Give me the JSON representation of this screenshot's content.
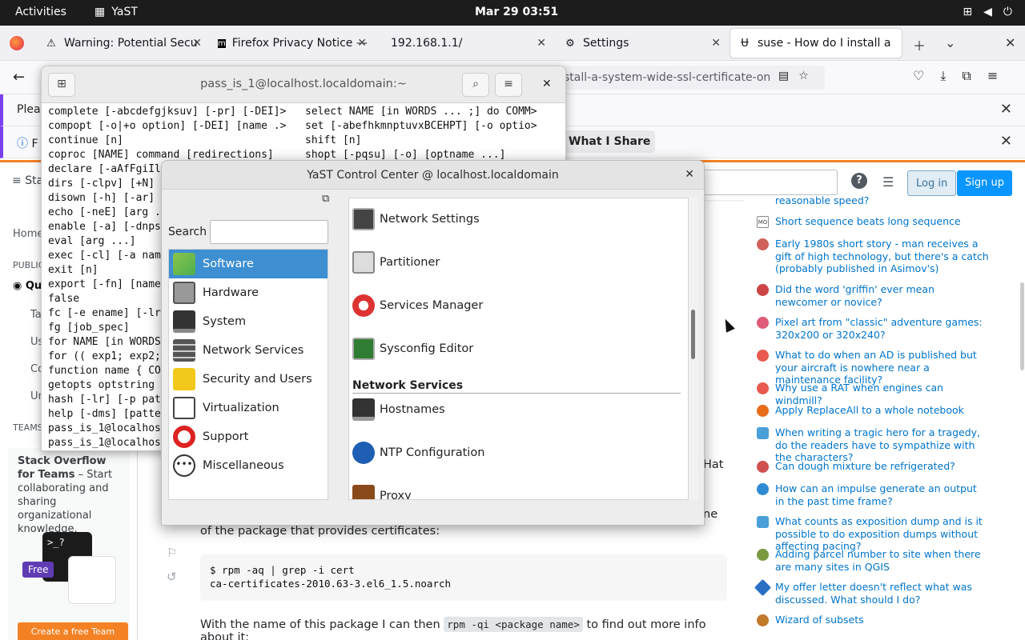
{
  "topbar": {
    "activities": "Activities",
    "app": "YaST",
    "clock": "Mar 29  03:51"
  },
  "tabs": [
    {
      "label": "Warning: Potential Secu",
      "icon": "warning-icon"
    },
    {
      "label": "Firefox Privacy Notice —",
      "icon": "mozilla-icon"
    },
    {
      "label": "192.168.1.1/",
      "icon": ""
    },
    {
      "label": "Settings",
      "icon": "gear-icon"
    },
    {
      "label": "suse - How do I install a",
      "icon": "stackexchange-icon"
    }
  ],
  "nav": {
    "url": "stall-a-system-wide-ssl-certificate-on"
  },
  "notif1": {
    "text": "Pleas"
  },
  "notif2": {
    "text": "F",
    "button": "What I Share"
  },
  "so_header": {
    "left": "Sta",
    "login": "Log in",
    "signup": "Sign up"
  },
  "so_left": {
    "home": "Home",
    "public": "PUBLIC",
    "questions": "Qu",
    "tags": "Ta",
    "users": "Us",
    "companies": "Co",
    "unanswered": "Un",
    "teams": "TEAMS",
    "teams_title": "Stack Overflow for Teams",
    "teams_desc": " – Start collaborating and sharing organizational knowledge.",
    "free": "Free",
    "create": "Create a free Team",
    "art_text": ">_?"
  },
  "so_main": {
    "hat": "Hat",
    "ne": "ne",
    "para1": "of the package that provides certificates:",
    "code_line1": "$ rpm -aq | grep -i cert",
    "code_line2": "ca-certificates-2010.63-3.el6_1.5.noarch",
    "para2_pre": "With the name of this package I can then ",
    "para2_code": "rpm -qi <package name>",
    "para2_post": " to find out more info about it:"
  },
  "hot_questions": [
    {
      "text": "reasonable speed?",
      "color": "#888"
    },
    {
      "text": "Short sequence beats long sequence",
      "color": "#444",
      "fav": "MO"
    },
    {
      "text": "Early 1980s short story - man receives a gift of high technology, but there's a catch (probably published in Asimov's)",
      "color": "#d0605a"
    },
    {
      "text": "Did the word 'griffin' ever mean newcomer or novice?",
      "color": "#c44"
    },
    {
      "text": "Pixel art from \"classic\" adventure games: 320x200 or 320x240?",
      "color": "#e05a7a"
    },
    {
      "text": "What to do when an AD is published but your aircraft is nowhere near a maintenance facility?",
      "color": "#e85a4f"
    },
    {
      "text": "Why use a RAT when engines can windmill?",
      "color": "#e85a4f"
    },
    {
      "text": "Apply ReplaceAll to a whole notebook",
      "color": "#e86c1a"
    },
    {
      "text": "When writing a tragic hero for a tragedy, do the readers have to sympathize with the characters?",
      "color": "#4a9fd8"
    },
    {
      "text": "Can dough mixture be refrigerated?",
      "color": "#d05050"
    },
    {
      "text": "How can an impulse generate an output in the past time frame?",
      "color": "#2f8ad6"
    },
    {
      "text": "What counts as exposition dump and is it possible to do exposition dumps without affecting pacing?",
      "color": "#4a9fd8"
    },
    {
      "text": "Adding parcel number to site when there are many sites in QGIS",
      "color": "#7a9a40"
    },
    {
      "text": "My offer letter doesn't reflect what was discussed. What should I do?",
      "color": "#2a6fc4"
    },
    {
      "text": "Wizard of subsets",
      "color": "#c07a2a"
    }
  ],
  "terminal": {
    "title": "pass_is_1@localhost.localdomain:~",
    "left_lines": [
      "complete [-abcdefgjksuv] [-pr] [-DEI]>",
      "compopt [-o|+o option] [-DEI] [name .>",
      "continue [n]",
      "coproc [NAME] command [redirections]",
      "declare [-aAfFgiIl",
      "dirs [-clpv] [+N]",
      "disown [-h] [-ar]",
      "echo [-neE] [arg .",
      "enable [-a] [-dnps",
      "eval [arg ...]",
      "exec [-cl] [-a nam",
      "exit [n]",
      "export [-fn] [name",
      "false",
      "fc [-e ename] [-lr",
      "fg [job_spec]",
      "for NAME [in WORDS",
      "for (( exp1; exp2;",
      "function name { CO",
      "getopts optstring",
      "hash [-lr] [-p pat",
      "help [-dms] [patte",
      "pass_is_1@localhost",
      "pass_is_1@localhost"
    ],
    "right_lines": [
      "select NAME [in WORDS ... ;] do COMM>",
      "set [-abefhkmnptuvxBCEHPT] [-o optio>",
      "shift [n]",
      "shopt [-pqsu] [-o] [optname ...]"
    ]
  },
  "yast": {
    "title": "YaST Control Center @ localhost.localdomain",
    "search_label": "Search",
    "search_value": "",
    "categories": [
      "Software",
      "Hardware",
      "System",
      "Network Services",
      "Security and Users",
      "Virtualization",
      "Support",
      "Miscellaneous"
    ],
    "modules": [
      "Network Settings",
      "Partitioner",
      "Services Manager",
      "Sysconfig Editor"
    ],
    "section": "Network Services",
    "section_modules": [
      "Hostnames",
      "NTP Configuration",
      "Proxy"
    ]
  }
}
